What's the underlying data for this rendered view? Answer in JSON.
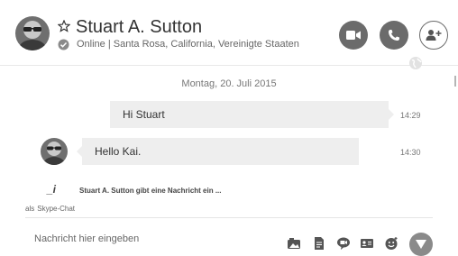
{
  "header": {
    "contact_name": "Stuart A. Sutton",
    "status": "Online",
    "separator": "|",
    "location": "Santa Rosa, California, Vereinigte Staaten",
    "buttons": {
      "video": "video-call",
      "call": "audio-call",
      "add": "add-participants"
    }
  },
  "conversation": {
    "date": "Montag, 20. Juli 2015",
    "messages": [
      {
        "direction": "outgoing",
        "text": "Hi Stuart",
        "time": "14:29"
      },
      {
        "direction": "incoming",
        "text": "Hello Kai.",
        "time": "14:30"
      }
    ],
    "typing": {
      "icon": "_i",
      "text": "Stuart A. Sutton gibt eine Nachricht ein ..."
    },
    "via": {
      "prefix": "als",
      "service": "Skype-Chat"
    }
  },
  "composer": {
    "placeholder": "Nachricht hier eingeben",
    "tools": [
      "send-photo-icon",
      "send-file-icon",
      "video-message-icon",
      "send-contact-icon",
      "emoticon-icon"
    ],
    "send": "send-icon"
  },
  "colors": {
    "icon_gray": "#6b6b6b",
    "bubble_bg": "#eeeeee",
    "send_bg": "#8a8a8a"
  }
}
